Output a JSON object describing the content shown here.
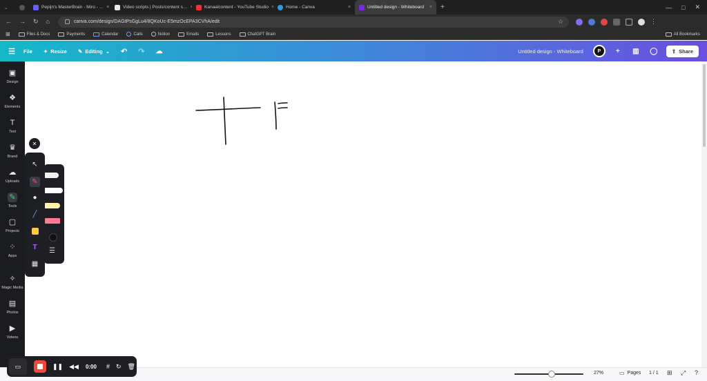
{
  "browser": {
    "tabs": [
      {
        "label": "Pepijn's MasterBrain - Miro - …",
        "color": "#6b5bff"
      },
      {
        "label": "Video scripts | Posts/content s…",
        "color": "#eaeaea"
      },
      {
        "label": "Kanaalcontent - YouTube Studio",
        "color": "#ff2d2d"
      },
      {
        "label": "Home - Canva",
        "color": "#2f9be0"
      },
      {
        "label": "Untitled design - Whiteboard",
        "color": "#7d2ae8"
      }
    ],
    "url": "canva.com/design/DAGtPsGgLu4/8QKoUc-E5mzOcEPA3CVhA/edit",
    "bookmarks": [
      "Files & Docs",
      "Payments",
      "Calendar",
      "Calls",
      "Notion",
      "Emails",
      "Lessons",
      "ChatGPT Brain"
    ],
    "all_bookmarks": "All Bookmarks"
  },
  "canva": {
    "file": "File",
    "resize": "Resize",
    "editing": "Editing",
    "doc_title": "Untitled design - Whiteboard",
    "avatar": "P",
    "share": "Share"
  },
  "sidebar": [
    {
      "label": "Design",
      "icon": "design-icon"
    },
    {
      "label": "Elements",
      "icon": "elements-icon"
    },
    {
      "label": "Text",
      "icon": "text-icon"
    },
    {
      "label": "Brand",
      "icon": "brand-icon"
    },
    {
      "label": "Uploads",
      "icon": "uploads-icon"
    },
    {
      "label": "Tools",
      "icon": "tools-icon"
    },
    {
      "label": "Projects",
      "icon": "projects-icon"
    },
    {
      "label": "Apps",
      "icon": "apps-icon"
    },
    {
      "label": "Magic Media",
      "icon": "magic-media-icon"
    },
    {
      "label": "Photos",
      "icon": "photos-icon"
    },
    {
      "label": "Videos",
      "icon": "videos-icon"
    }
  ],
  "status": {
    "zoom": "27%",
    "pages": "Pages",
    "page_count": "1 / 1"
  },
  "recorder": {
    "time": "0:00"
  }
}
